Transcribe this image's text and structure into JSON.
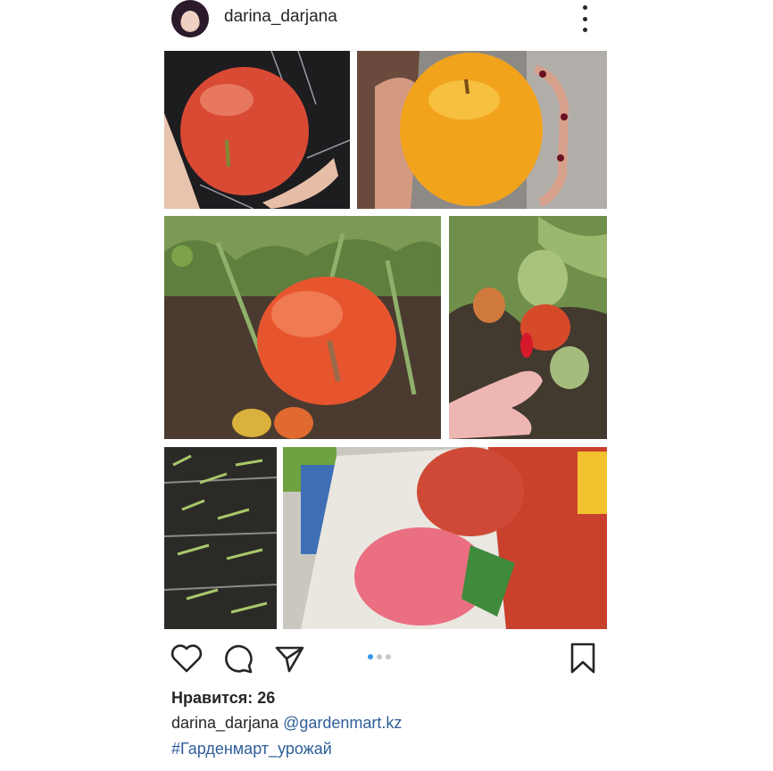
{
  "post": {
    "username": "darina_darjana",
    "likes_text": "Нравится: 26",
    "caption_user": "darina_darjana",
    "caption_mention": "@gardenmart.kz",
    "hashtag": "#Гарденмарт_урожай",
    "carousel_index": 1,
    "carousel_count": 3
  },
  "icons": {
    "more": "more-vertical-icon",
    "like": "heart-icon",
    "comment": "comment-icon",
    "share": "send-icon",
    "save": "bookmark-icon"
  },
  "colors": {
    "text": "#262626",
    "link": "#2f5e99",
    "dot_active": "#3897f0",
    "dot_inactive": "#c7c7c7"
  }
}
